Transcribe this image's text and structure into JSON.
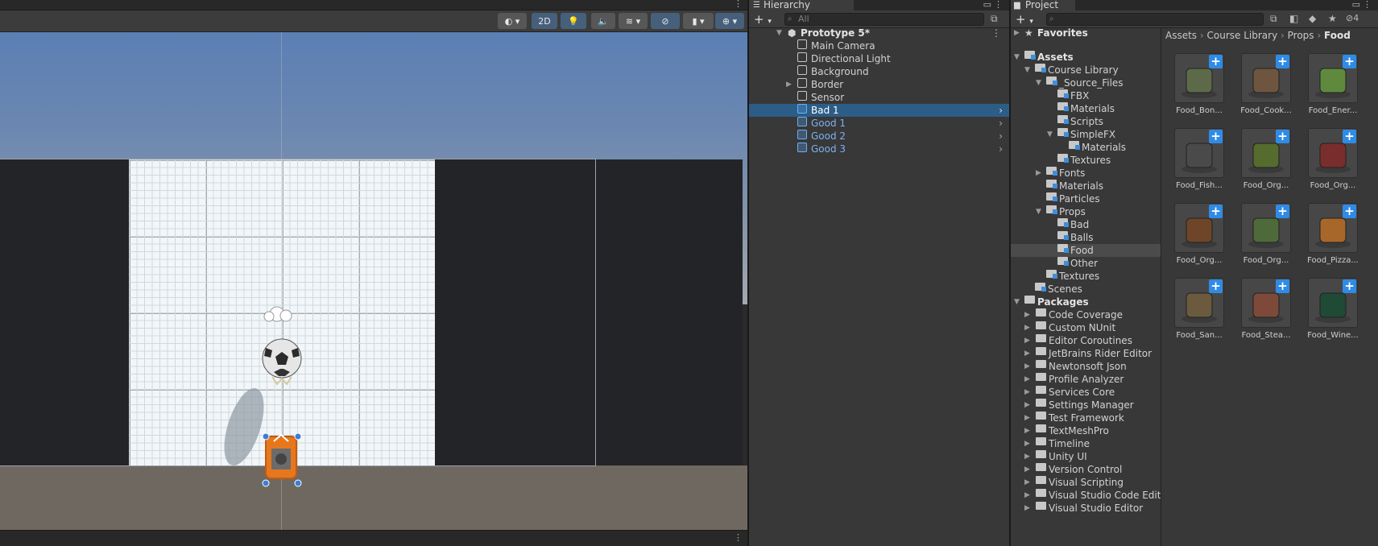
{
  "scene": {
    "toolbar": {
      "mode_2d": "2D"
    }
  },
  "hierarchy": {
    "tab_label": "Hierarchy",
    "search_placeholder": "All",
    "items": [
      {
        "label": "Prototype 5*",
        "kind": "scene"
      },
      {
        "label": "Main Camera",
        "kind": "object"
      },
      {
        "label": "Directional Light",
        "kind": "object"
      },
      {
        "label": "Background",
        "kind": "object"
      },
      {
        "label": "Border",
        "kind": "object"
      },
      {
        "label": "Sensor",
        "kind": "object"
      },
      {
        "label": "Bad 1",
        "kind": "prefab",
        "selected": true
      },
      {
        "label": "Good 1",
        "kind": "prefab"
      },
      {
        "label": "Good 2",
        "kind": "prefab"
      },
      {
        "label": "Good 3",
        "kind": "prefab"
      }
    ]
  },
  "project": {
    "tab_label": "Project",
    "hidden_count": "4",
    "breadcrumb": [
      "Assets",
      "Course Library",
      "Props",
      "Food"
    ],
    "tree": [
      {
        "label": "Favorites"
      },
      {
        "label": "Assets"
      },
      {
        "label": "Course Library"
      },
      {
        "label": "_Source_Files"
      },
      {
        "label": "FBX"
      },
      {
        "label": "Materials"
      },
      {
        "label": "Scripts"
      },
      {
        "label": "SimpleFX"
      },
      {
        "label": "Materials"
      },
      {
        "label": "Textures"
      },
      {
        "label": "Fonts"
      },
      {
        "label": "Materials"
      },
      {
        "label": "Particles"
      },
      {
        "label": "Props"
      },
      {
        "label": "Bad"
      },
      {
        "label": "Balls"
      },
      {
        "label": "Food"
      },
      {
        "label": "Other"
      },
      {
        "label": "Textures"
      },
      {
        "label": "Scenes"
      },
      {
        "label": "Packages"
      },
      {
        "label": "Code Coverage"
      },
      {
        "label": "Custom NUnit"
      },
      {
        "label": "Editor Coroutines"
      },
      {
        "label": "JetBrains Rider Editor"
      },
      {
        "label": "Newtonsoft Json"
      },
      {
        "label": "Profile Analyzer"
      },
      {
        "label": "Services Core"
      },
      {
        "label": "Settings Manager"
      },
      {
        "label": "Test Framework"
      },
      {
        "label": "TextMeshPro"
      },
      {
        "label": "Timeline"
      },
      {
        "label": "Unity UI"
      },
      {
        "label": "Version Control"
      },
      {
        "label": "Visual Scripting"
      },
      {
        "label": "Visual Studio Code Edito"
      },
      {
        "label": "Visual Studio Editor"
      }
    ],
    "assets": [
      {
        "label": "Food_Bon...",
        "color": "#5d6a4a"
      },
      {
        "label": "Food_Cook...",
        "color": "#6e5540"
      },
      {
        "label": "Food_Ener...",
        "color": "#5f8a3e"
      },
      {
        "label": "Food_Fish...",
        "color": "#4a4a4a"
      },
      {
        "label": "Food_Org...",
        "color": "#566b2e"
      },
      {
        "label": "Food_Org...",
        "color": "#7a2d2d"
      },
      {
        "label": "Food_Org...",
        "color": "#6e4528"
      },
      {
        "label": "Food_Org...",
        "color": "#4f6a3a"
      },
      {
        "label": "Food_Pizza...",
        "color": "#a8672a"
      },
      {
        "label": "Food_San...",
        "color": "#6b5a3e"
      },
      {
        "label": "Food_Stea...",
        "color": "#7d4a3a"
      },
      {
        "label": "Food_Wine...",
        "color": "#1f4a35"
      }
    ]
  }
}
